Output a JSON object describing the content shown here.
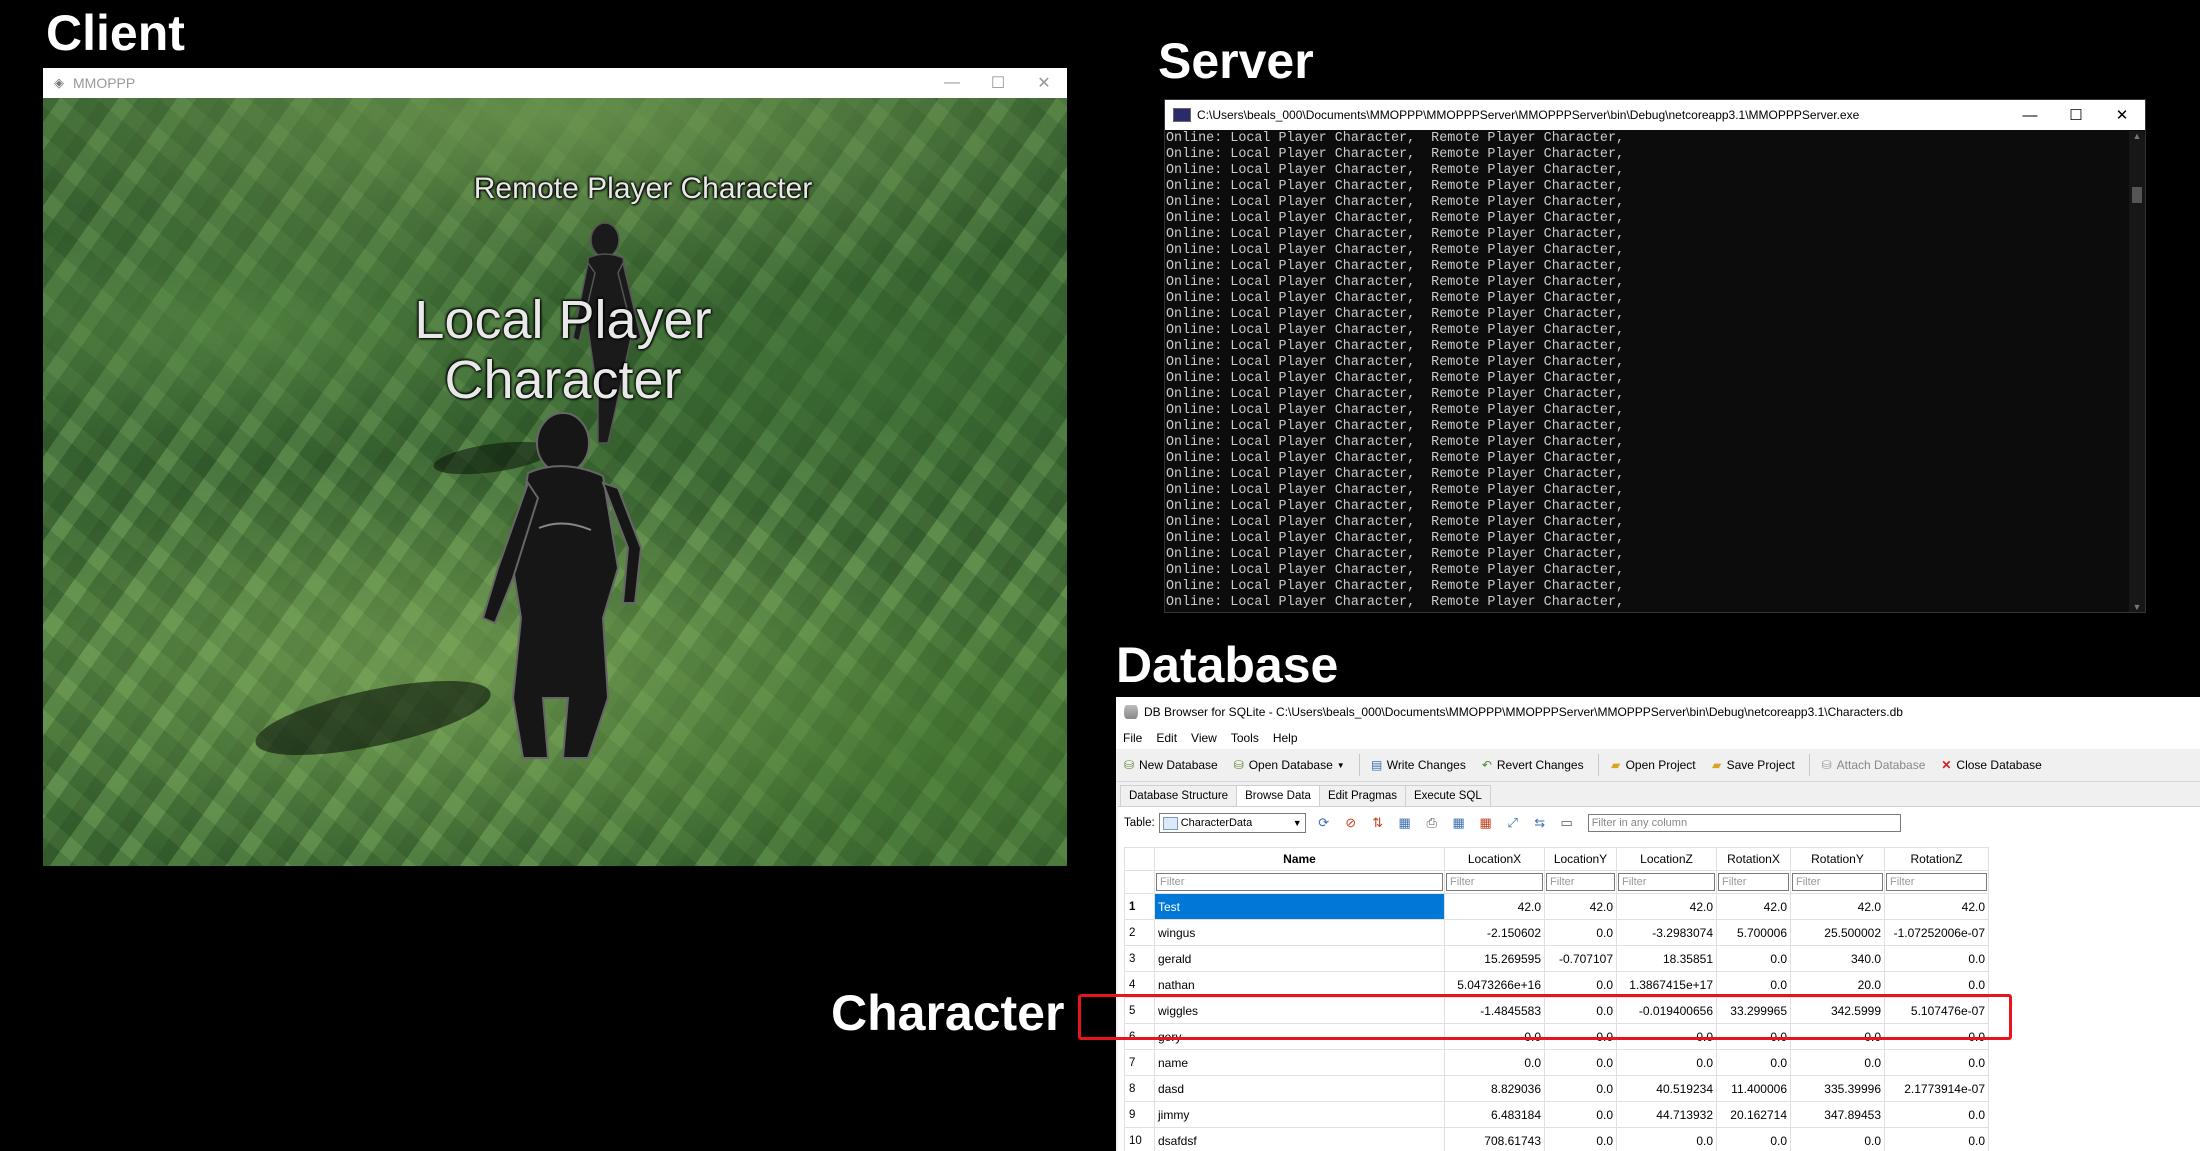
{
  "labels": {
    "client": "Client",
    "server": "Server",
    "database": "Database",
    "character": "Character"
  },
  "client": {
    "title": "MMOPPP",
    "remote_label": "Remote Player Character",
    "local_label": "Local Player Character",
    "controls": {
      "minimize": "—",
      "maximize": "☐",
      "close": "✕"
    }
  },
  "server": {
    "title": "C:\\Users\\beals_000\\Documents\\MMOPPP\\MMOPPPServer\\MMOPPPServer\\bin\\Debug\\netcoreapp3.1\\MMOPPPServer.exe",
    "console_line": "Online: Local Player Character,  Remote Player Character,",
    "line_count": 30,
    "controls": {
      "minimize": "—",
      "maximize": "☐",
      "close": "✕"
    }
  },
  "db": {
    "title": "DB Browser for SQLite - C:\\Users\\beals_000\\Documents\\MMOPPP\\MMOPPPServer\\MMOPPPServer\\bin\\Debug\\netcoreapp3.1\\Characters.db",
    "menu": [
      "File",
      "Edit",
      "View",
      "Tools",
      "Help"
    ],
    "toolbar": {
      "new_database": "New Database",
      "open_database": "Open Database",
      "write_changes": "Write Changes",
      "revert_changes": "Revert Changes",
      "open_project": "Open Project",
      "save_project": "Save Project",
      "attach_database": "Attach Database",
      "close_database": "Close Database"
    },
    "tabs": [
      "Database Structure",
      "Browse Data",
      "Edit Pragmas",
      "Execute SQL"
    ],
    "active_tab": "Browse Data",
    "table_label": "Table:",
    "table_value": "CharacterData",
    "filter_all_placeholder": "Filter in any column",
    "filter_placeholder": "Filter",
    "columns": [
      "Name",
      "LocationX",
      "LocationY",
      "LocationZ",
      "RotationX",
      "RotationY",
      "RotationZ"
    ],
    "rows": [
      [
        "1",
        "Test",
        "42.0",
        "42.0",
        "42.0",
        "42.0",
        "42.0",
        "42.0"
      ],
      [
        "2",
        "wingus",
        "-2.150602",
        "0.0",
        "-3.2983074",
        "5.700006",
        "25.500002",
        "-1.07252006e-07"
      ],
      [
        "3",
        "gerald",
        "15.269595",
        "-0.707107",
        "18.35851",
        "0.0",
        "340.0",
        "0.0"
      ],
      [
        "4",
        "nathan",
        "5.0473266e+16",
        "0.0",
        "1.3867415e+17",
        "0.0",
        "20.0",
        "0.0"
      ],
      [
        "5",
        "wiggles",
        "-1.4845583",
        "0.0",
        "-0.019400656",
        "33.299965",
        "342.5999",
        "5.107476e-07"
      ],
      [
        "6",
        "gery",
        "0.0",
        "0.0",
        "0.0",
        "0.0",
        "0.0",
        "0.0"
      ],
      [
        "7",
        "name",
        "0.0",
        "0.0",
        "0.0",
        "0.0",
        "0.0",
        "0.0"
      ],
      [
        "8",
        "dasd",
        "8.829036",
        "0.0",
        "40.519234",
        "11.400006",
        "335.39996",
        "2.1773914e-07"
      ],
      [
        "9",
        "jimmy",
        "6.483184",
        "0.0",
        "44.713932",
        "20.162714",
        "347.89453",
        "0.0"
      ],
      [
        "10",
        "dsafdsf",
        "708.61743",
        "0.0",
        "0.0",
        "0.0",
        "0.0",
        "0.0"
      ]
    ],
    "selected_row": 0,
    "highlighted_row": 4
  }
}
